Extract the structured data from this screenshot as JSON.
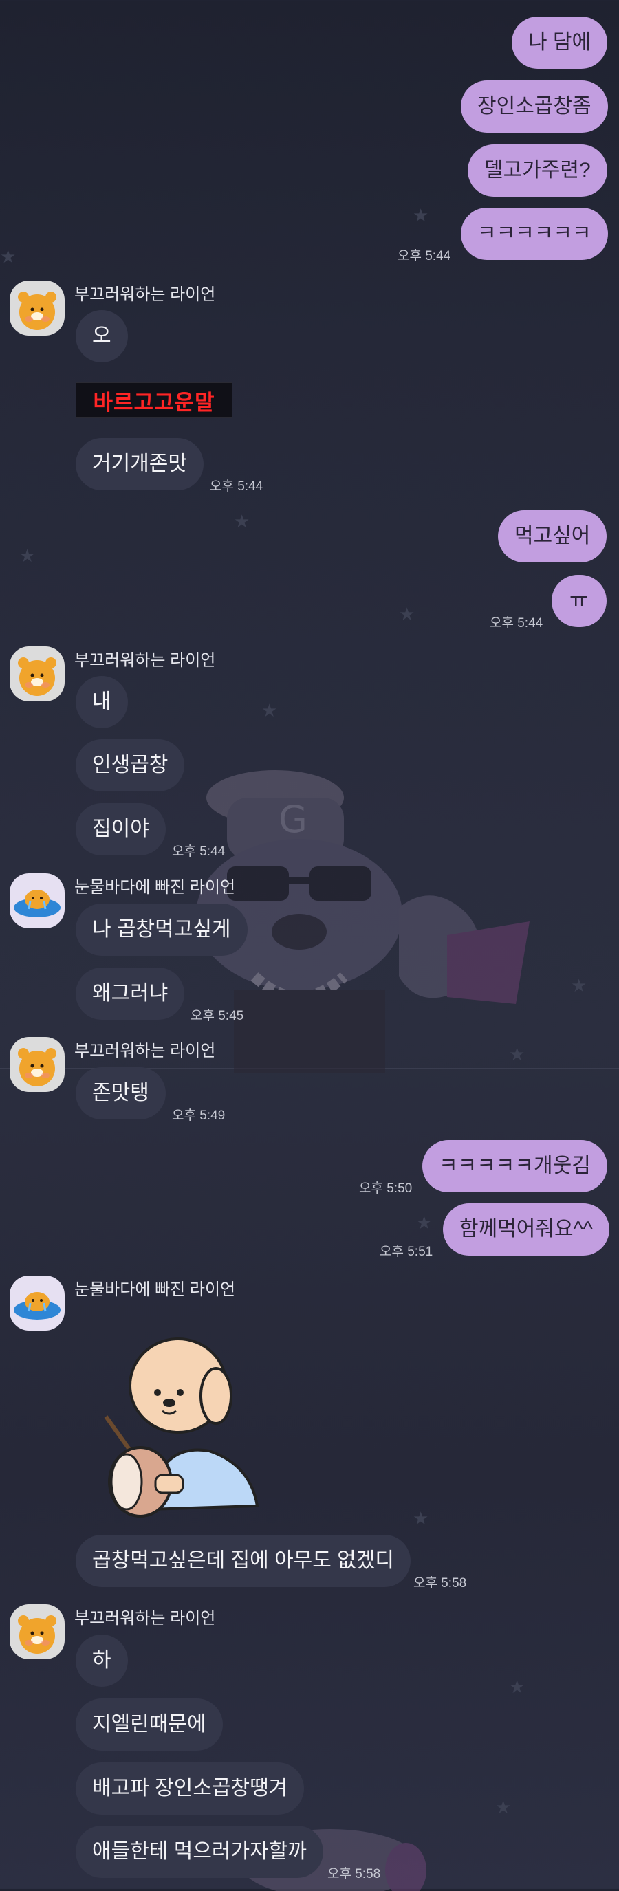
{
  "sender_a": "부끄러워하는 라이언",
  "sender_b": "눈물바다에 빠진 라이언",
  "hidden_text": "바르고고운말",
  "messages": {
    "m1": "나 담에",
    "m2": "장인소곱창좀",
    "m3": "델고가주련?",
    "m4": "ㅋㅋㅋㅋㅋㅋ",
    "m4_time": "오후 5:44",
    "r1": "오",
    "r3": "거기개존맛",
    "r3_time": "오후 5:44",
    "m5": "먹고싶어",
    "m6": "ㅠ",
    "m6_time": "오후 5:44",
    "r4": "내",
    "r5": "인생곱창",
    "r6": "집이야",
    "r6_time": "오후 5:44",
    "b1": "나 곱창먹고싶게",
    "b2": "왜그러냐",
    "b2_time": "오후 5:45",
    "r7": "존맛탱",
    "r7_time": "오후 5:49",
    "m7": "ㅋㅋㅋㅋㅋ개웃김",
    "m7_time": "오후 5:50",
    "m8": "함께먹어줘요^^",
    "m8_time": "오후 5:51",
    "b3": "곱창먹고싶은데 집에 아무도 없겠디",
    "b3_time": "오후 5:58",
    "r8": "하",
    "r9": "지엘린때문에",
    "r10": "배고파 장인소곱창땡겨",
    "r11": "애들한테 먹으러가자할까",
    "r11_time": "오후 5:58"
  },
  "colors": {
    "my_bubble": "#c29ee0",
    "their_bubble": "#34374a",
    "hidden_text": "#ff2525",
    "background": "#252838"
  },
  "icons": {
    "avatar_a": "ryan-shy-avatar",
    "avatar_b": "ryan-crying-avatar",
    "sticker": "puppy-drum-sticker"
  }
}
